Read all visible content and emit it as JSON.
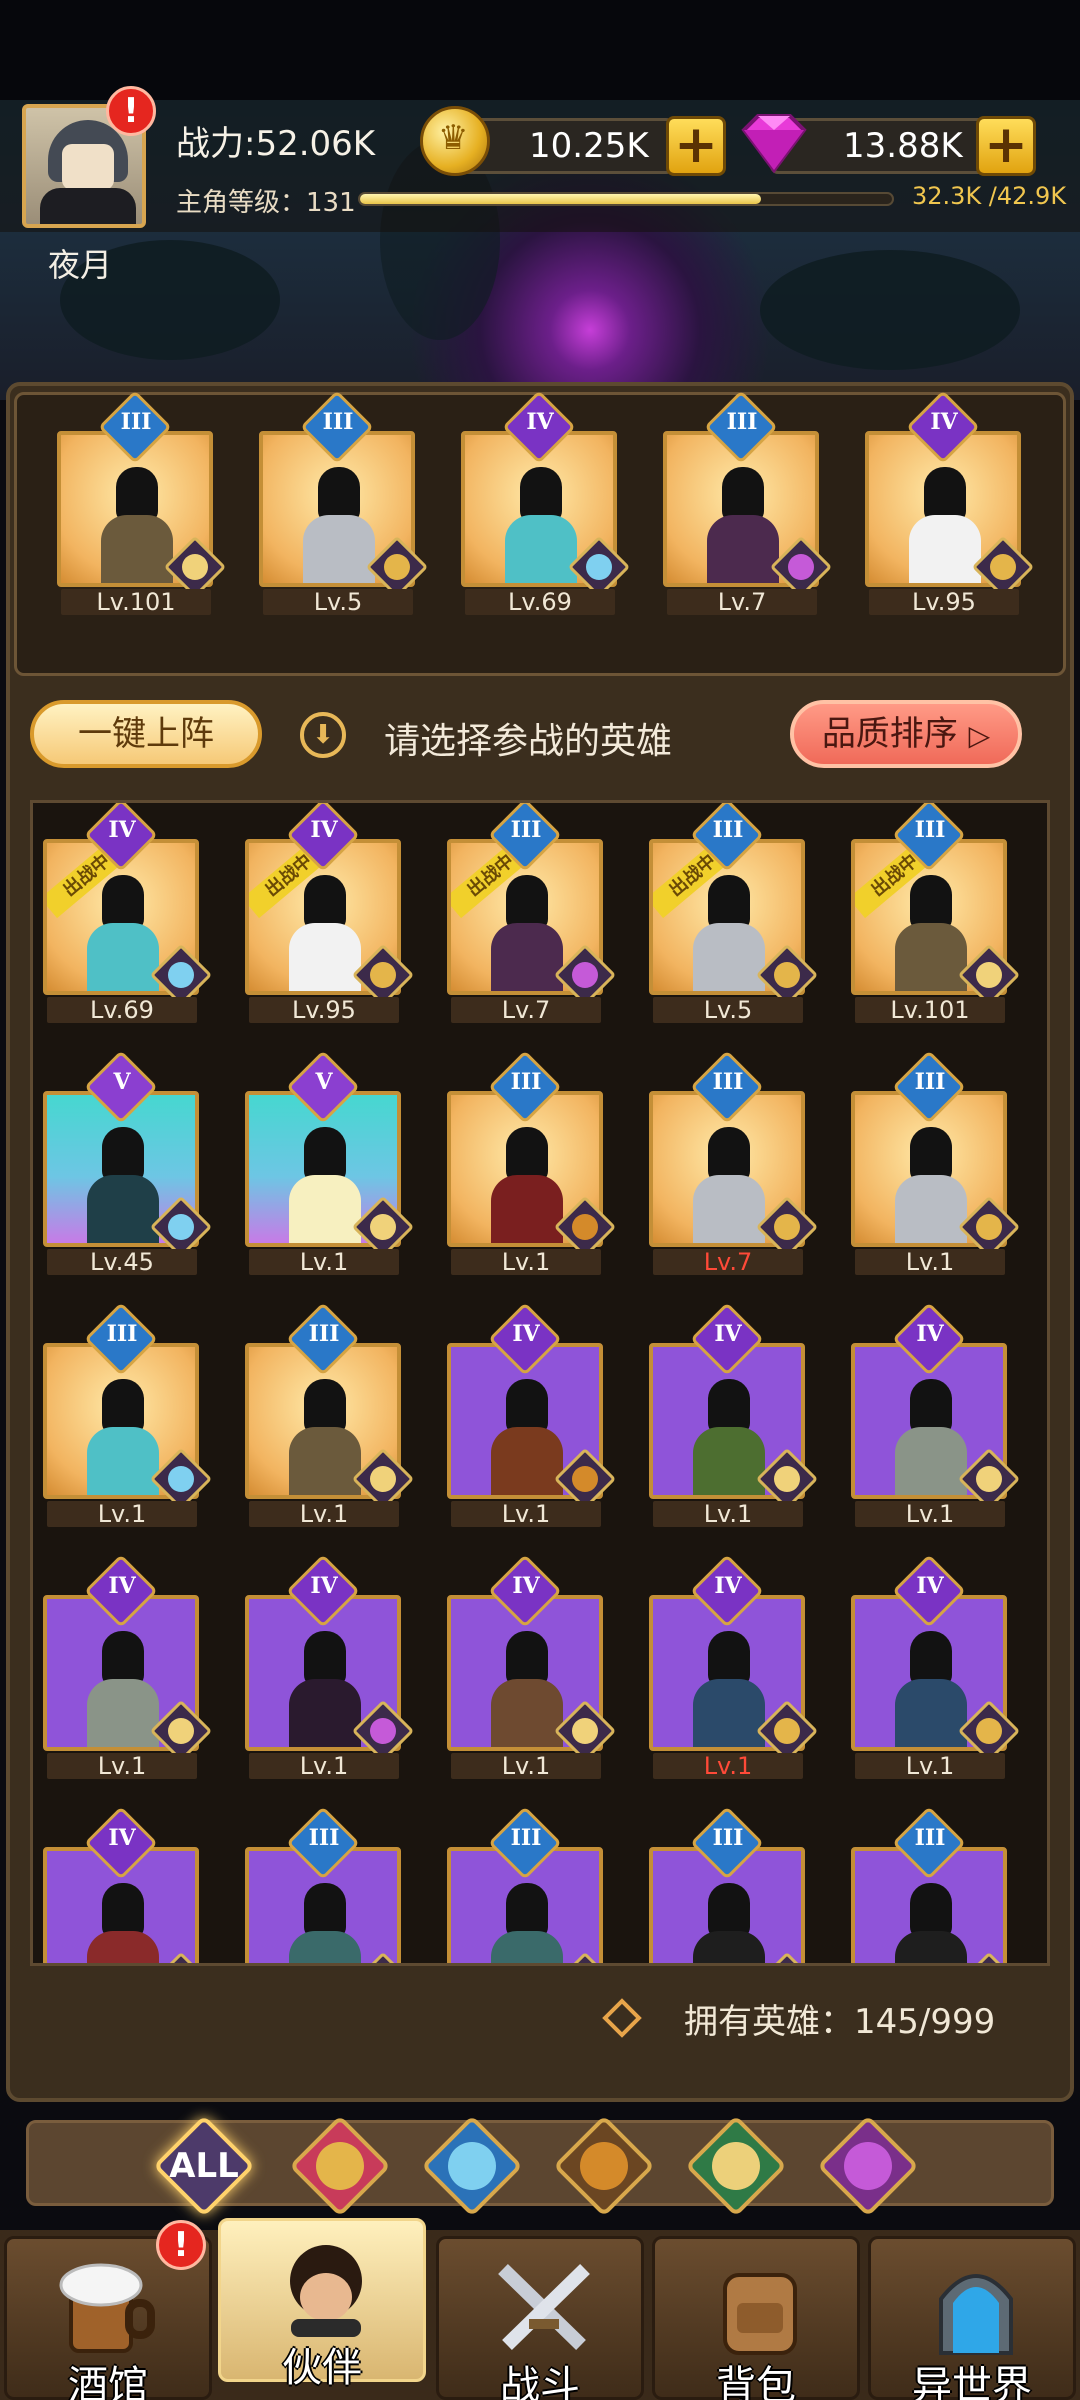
{
  "player": {
    "name": "夜月",
    "power": "战力:52.06K",
    "level_label": "主角等级：131",
    "xp_text": "32.3K /42.9K",
    "xp_fraction": 0.753
  },
  "resources": {
    "gold": "10.25K",
    "gems": "13.88K"
  },
  "team": [
    {
      "level": "Lv.101",
      "rank": "III"
    },
    {
      "level": "Lv.5",
      "rank": "III"
    },
    {
      "level": "Lv.69",
      "rank": "IV"
    },
    {
      "level": "Lv.7",
      "rank": "III"
    },
    {
      "level": "Lv.95",
      "rank": "IV"
    }
  ],
  "actions": {
    "auto_deploy": "一键上阵",
    "hint": "请选择参战的英雄",
    "sort": "品质排序",
    "deployed_tag": "出战中"
  },
  "heroes": [
    {
      "level": "Lv.69",
      "rank": "IV"
    },
    {
      "level": "Lv.95",
      "rank": "IV"
    },
    {
      "level": "Lv.7",
      "rank": "III"
    },
    {
      "level": "Lv.5",
      "rank": "III"
    },
    {
      "level": "Lv.101",
      "rank": "III"
    },
    {
      "level": "Lv.45",
      "rank": "V"
    },
    {
      "level": "Lv.1",
      "rank": "V"
    },
    {
      "level": "Lv.1",
      "rank": "III"
    },
    {
      "level": "Lv.7",
      "rank": "III"
    },
    {
      "level": "Lv.1",
      "rank": "III"
    },
    {
      "level": "Lv.1",
      "rank": "III"
    },
    {
      "level": "Lv.1",
      "rank": "III"
    },
    {
      "level": "Lv.1",
      "rank": "IV"
    },
    {
      "level": "Lv.1",
      "rank": "IV"
    },
    {
      "level": "Lv.1",
      "rank": "IV"
    },
    {
      "level": "Lv.1",
      "rank": "IV"
    },
    {
      "level": "Lv.1",
      "rank": "IV"
    },
    {
      "level": "Lv.1",
      "rank": "IV"
    },
    {
      "level": "Lv.1",
      "rank": "IV"
    },
    {
      "level": "Lv.1",
      "rank": "IV"
    },
    {
      "rank": "IV"
    },
    {
      "rank": "III"
    },
    {
      "rank": "III"
    },
    {
      "rank": "III"
    },
    {
      "rank": "III"
    }
  ],
  "owned": "拥有英雄：145/999",
  "filters": {
    "all": "ALL"
  },
  "nav": {
    "tavern": "酒馆",
    "partner": "伙伴",
    "battle": "战斗",
    "bag": "背包",
    "otherworld": "异世界"
  },
  "alerts": {
    "mark": "!"
  },
  "colors": {
    "gold_border": "#c48f37",
    "purple_quality": "#8f54d9",
    "gold_quality": "#f2b460",
    "level_red": "#ff4a38"
  }
}
